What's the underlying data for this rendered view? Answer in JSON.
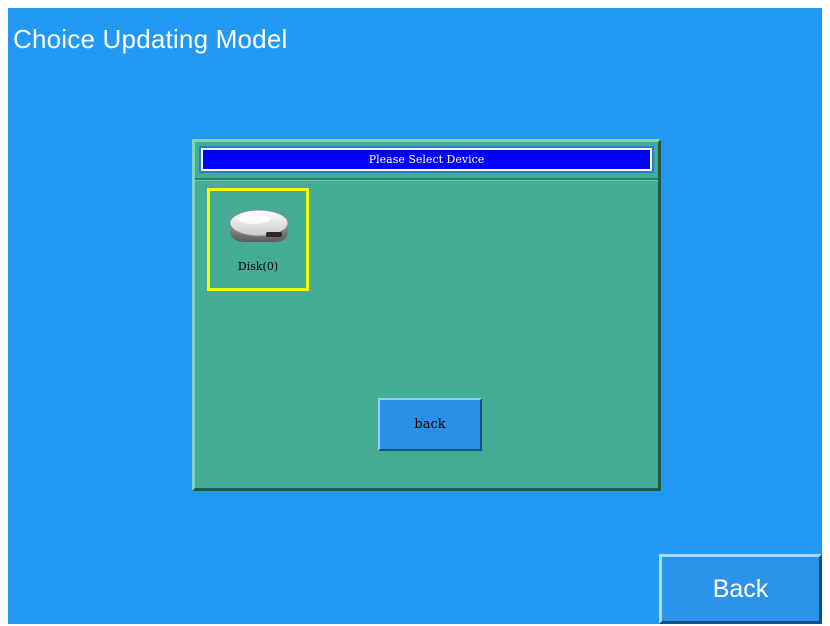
{
  "header": {
    "title": "Choice Updating Model"
  },
  "dialog": {
    "title": "Please Select Device",
    "devices": [
      {
        "label": "Disk(0)",
        "icon": "disk-drive-icon",
        "selected": true
      }
    ],
    "back_label": "back"
  },
  "footer": {
    "back_label": "Back"
  },
  "colors": {
    "background": "#2299f4",
    "dialog_body": "#44ab94",
    "dialog_title_bar": "#0000ff",
    "selection_border": "#f2ff00",
    "button": "#2c93ea"
  }
}
